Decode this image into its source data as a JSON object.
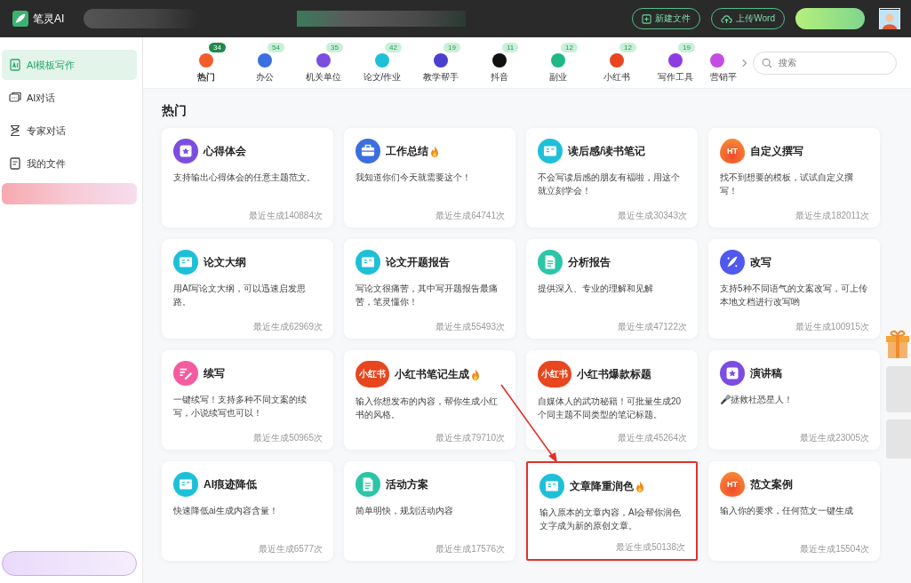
{
  "brand": {
    "name": "笔灵AI"
  },
  "top_actions": [
    {
      "label": "新建文件",
      "kind": "new"
    },
    {
      "label": "上传Word",
      "kind": "upload"
    }
  ],
  "sidebar": {
    "items": [
      {
        "label": "AI模板写作",
        "selected": true,
        "kind": "template"
      },
      {
        "label": "AI对话",
        "selected": false,
        "kind": "chat"
      },
      {
        "label": "专家对话",
        "selected": false,
        "kind": "expert"
      },
      {
        "label": "我的文件",
        "selected": false,
        "kind": "file"
      }
    ]
  },
  "categories": [
    {
      "label": "热门",
      "count": "34",
      "selected": true
    },
    {
      "label": "办公",
      "count": "54",
      "selected": false
    },
    {
      "label": "机关单位",
      "count": "35",
      "selected": false
    },
    {
      "label": "论文/作业",
      "count": "42",
      "selected": false
    },
    {
      "label": "教学帮手",
      "count": "19",
      "selected": false
    },
    {
      "label": "抖音",
      "count": "11",
      "selected": false
    },
    {
      "label": "副业",
      "count": "12",
      "selected": false
    },
    {
      "label": "小红书",
      "count": "12",
      "selected": false
    },
    {
      "label": "写作工具",
      "count": "19",
      "selected": false
    },
    {
      "label": "营销平",
      "selected": false
    }
  ],
  "search": {
    "placeholder": "搜索"
  },
  "section_title": "热门",
  "cards": [
    {
      "title": "心得体会",
      "hot": false,
      "desc": "支持输出心得体会的任意主题范文。",
      "stat": "最近生成140884次"
    },
    {
      "title": "工作总结",
      "hot": true,
      "desc": "我知道你们今天就需要这个！",
      "stat": "最近生成64741次"
    },
    {
      "title": "读后感/读书笔记",
      "hot": false,
      "desc": "不会写读后感的朋友有福啦，用这个就立刻学会！",
      "stat": "最近生成30343次"
    },
    {
      "title": "自定义撰写",
      "hot": false,
      "icon_label": "HT",
      "desc": "找不到想要的模板，试试自定义撰写！",
      "stat": "最近生成182011次"
    },
    {
      "title": "论文大纲",
      "hot": false,
      "desc": "用AI写论文大纲，可以迅速启发思路。",
      "stat": "最近生成62969次"
    },
    {
      "title": "论文开题报告",
      "hot": false,
      "desc": "写论文很痛苦，其中写开题报告最痛苦，笔灵懂你！",
      "stat": "最近生成55493次"
    },
    {
      "title": "分析报告",
      "hot": false,
      "desc": "提供深入、专业的理解和见解",
      "stat": "最近生成47122次"
    },
    {
      "title": "改写",
      "hot": false,
      "desc": "支持5种不同语气的文案改写，可上传本地文档进行改写哟",
      "stat": "最近生成100915次"
    },
    {
      "title": "续写",
      "hot": false,
      "desc": "一键续写！支持多种不同文案的续写，小说续写也可以！",
      "stat": "最近生成50965次"
    },
    {
      "title": "小红书笔记生成",
      "hot": true,
      "icon_label": "小红书",
      "desc": "输入你想发布的内容，帮你生成小红书的风格。",
      "stat": "最近生成79710次"
    },
    {
      "title": "小红书爆款标题",
      "hot": false,
      "icon_label": "小红书",
      "desc": "自媒体人的武功秘籍！可批量生成20个同主题不同类型的笔记标题。",
      "stat": "最近生成45264次"
    },
    {
      "title": "演讲稿",
      "hot": false,
      "desc": "🎤拯救社恐星人！",
      "stat": "最近生成23005次"
    },
    {
      "title": "AI痕迹降低",
      "hot": false,
      "desc": "快速降低ai生成内容含量！",
      "stat": "最近生成6577次"
    },
    {
      "title": "活动方案",
      "hot": false,
      "desc": "简单明快，规划活动内容",
      "stat": "最近生成17576次"
    },
    {
      "title": "文章降重润色",
      "hot": true,
      "highlighted": true,
      "desc": "输入原本的文章内容，AI会帮你润色文字成为新的原创文章。",
      "stat": "最近生成50138次"
    },
    {
      "title": "范文案例",
      "hot": false,
      "icon_label": "HT",
      "desc": "输入你的要求，任何范文一键生成",
      "stat": "最近生成15504次"
    }
  ]
}
